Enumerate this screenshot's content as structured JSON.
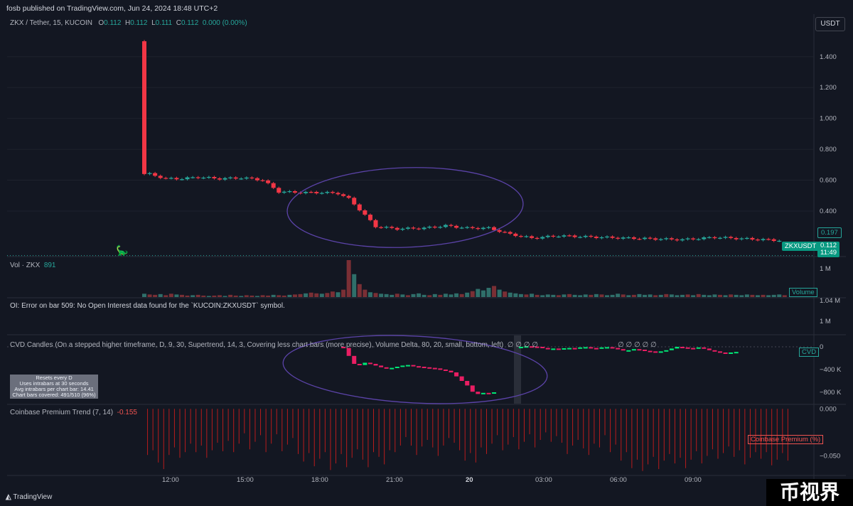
{
  "header": {
    "published": "fosb published on TradingView.com, Jun 24, 2024 18:48 UTC+2",
    "currency": "USDT"
  },
  "symbol_legend": {
    "name": "ZKX / Tether, 15, KUCOIN",
    "o_label": "O",
    "o": "0.112",
    "h_label": "H",
    "h": "0.112",
    "l_label": "L",
    "l": "0.111",
    "c_label": "C",
    "c": "0.112",
    "change": "0.000 (0.00%)"
  },
  "price_tags": {
    "last_line": "0.197",
    "symbol": "ZKXUSDT",
    "price": "0.112",
    "countdown": "11:49"
  },
  "volume_pane": {
    "title": "Vol · ZKX",
    "value": "891",
    "tag": "Volume"
  },
  "oi_pane": {
    "error": "OI: Error on bar 509: No Open Interest data found for the `KUCOIN:ZKXUSDT` symbol."
  },
  "cvd_pane": {
    "title": "CVD Candles (On a stepped higher timeframe, D, 9, 30, Supertrend, 14, 3, Covering less chart bars (more precise), Volume Delta, 80, 20, small, bottom, left)",
    "markers": "∅ ∅ ∅ ∅",
    "markers2": "∅ ∅ ∅ ∅ ∅",
    "tag": "CVD",
    "info_lines": [
      "Resets every D",
      "Uses intrabars at 30 seconds",
      "Avg intrabars per chart bar: 14.41",
      "Chart bars covered: 491/510 (96%)"
    ]
  },
  "premium_pane": {
    "title": "Coinbase Premium Trend (7, 14)",
    "value": "-0.155",
    "tag": "Coinbase Premium (%)"
  },
  "footer": {
    "logo": "TradingView",
    "watermark": "币视界"
  },
  "colors": {
    "bg": "#131722",
    "up": "#26a69a",
    "down": "#f23645",
    "cvd_up": "#00e676",
    "cvd_down": "#e91e63",
    "premium": "#b71c1c",
    "annotation": "#5b43a8"
  },
  "chart_data": [
    {
      "type": "candlestick",
      "title": "ZKX / Tether, 15, KUCOIN",
      "y_ticks": [
        "1.400",
        "1.200",
        "1.000",
        "0.800",
        "0.600",
        "0.400"
      ],
      "ylim": [
        0.11,
        1.56
      ],
      "x_ticks": [
        "12:00",
        "15:00",
        "18:00",
        "21:00",
        "20",
        "03:00",
        "06:00",
        "09:00"
      ],
      "close_path": [
        [
          0,
          1.5,
          0.64
        ],
        [
          1,
          0.64,
          0.61
        ],
        [
          4,
          0.61,
          0.61
        ],
        [
          7,
          0.61,
          0.62
        ],
        [
          10,
          0.62,
          0.61
        ],
        [
          14,
          0.61,
          0.615
        ],
        [
          18,
          0.615,
          0.61
        ],
        [
          20,
          0.61,
          0.6
        ],
        [
          22,
          0.6,
          0.525
        ],
        [
          25,
          0.525,
          0.52
        ],
        [
          30,
          0.52,
          0.52
        ],
        [
          33,
          0.52,
          0.515
        ],
        [
          36,
          0.515,
          0.48
        ],
        [
          38,
          0.48,
          0.41
        ],
        [
          40,
          0.41,
          0.3
        ],
        [
          43,
          0.3,
          0.285
        ],
        [
          47,
          0.285,
          0.29
        ],
        [
          52,
          0.29,
          0.305
        ],
        [
          56,
          0.305,
          0.29
        ],
        [
          60,
          0.29,
          0.29
        ],
        [
          64,
          0.29,
          0.25
        ],
        [
          68,
          0.25,
          0.225
        ],
        [
          72,
          0.225,
          0.24
        ],
        [
          77,
          0.24,
          0.23
        ],
        [
          85,
          0.23,
          0.22
        ],
        [
          95,
          0.22,
          0.215
        ],
        [
          100,
          0.215,
          0.23
        ],
        [
          106,
          0.23,
          0.22
        ],
        [
          112,
          0.22,
          0.21
        ],
        [
          118,
          0.21,
          0.197
        ]
      ],
      "last_price": 0.197,
      "current_price": 0.112,
      "annotation": "hand-drawn ellipse"
    },
    {
      "type": "bar",
      "title": "Vol · ZKX",
      "y_ticks": [
        "1 M",
        "1.04 M"
      ],
      "values": [
        0.09,
        0.07,
        0.06,
        0.08,
        0.05,
        0.09,
        0.07,
        0.06,
        0.04,
        0.05,
        0.06,
        0.04,
        0.03,
        0.04,
        0.05,
        0.03,
        0.06,
        0.04,
        0.03,
        0.05,
        0.04,
        0.03,
        0.05,
        0.04,
        0.06,
        0.05,
        0.04,
        0.06,
        0.07,
        0.08,
        0.1,
        0.12,
        0.1,
        0.09,
        0.11,
        0.15,
        0.13,
        0.2,
        1.0,
        0.62,
        0.35,
        0.2,
        0.13,
        0.11,
        0.09,
        0.08,
        0.06,
        0.09,
        0.07,
        0.05,
        0.08,
        0.1,
        0.06,
        0.05,
        0.08,
        0.06,
        0.09,
        0.07,
        0.1,
        0.08,
        0.12,
        0.16,
        0.22,
        0.18,
        0.25,
        0.3,
        0.2,
        0.15,
        0.12,
        0.1,
        0.08,
        0.07,
        0.09,
        0.06,
        0.05,
        0.07,
        0.06,
        0.05,
        0.07,
        0.08,
        0.06,
        0.05,
        0.07,
        0.06,
        0.08,
        0.07,
        0.05,
        0.06,
        0.09,
        0.07,
        0.05,
        0.06,
        0.08,
        0.06,
        0.07,
        0.05,
        0.06,
        0.08,
        0.07,
        0.05,
        0.06,
        0.07,
        0.05,
        0.08,
        0.06,
        0.05,
        0.07,
        0.06,
        0.05,
        0.07,
        0.06,
        0.05,
        0.07,
        0.06,
        0.05,
        0.06,
        0.05,
        0.06,
        0.07,
        0.05
      ]
    },
    {
      "type": "candlestick",
      "title": "CVD Candles",
      "y_ticks": [
        "0",
        "−400 K",
        "−800 K"
      ],
      "ylim": [
        -1000,
        200
      ],
      "x_ticks": [
        "03:00"
      ],
      "first_bar": 37,
      "closes": [
        -20,
        -160,
        -300,
        -320,
        -280,
        -300,
        -330,
        -360,
        -380,
        -370,
        -350,
        -330,
        -320,
        -340,
        -350,
        -360,
        -370,
        -380,
        -400,
        -420,
        -450,
        -520,
        -600,
        -680,
        -790,
        -830,
        -810,
        -820,
        -800
      ],
      "closes2": [
        0,
        10,
        5,
        0,
        -20,
        -30,
        -30,
        -35,
        -25,
        -20,
        -35,
        -10,
        -5,
        -20,
        -30,
        -10,
        -5,
        -20,
        -40,
        -60,
        -60,
        -40,
        -50,
        -70,
        -80,
        -90,
        -80,
        -60,
        -30,
        0,
        -10,
        -20,
        -30,
        -10,
        -30,
        -60,
        -80,
        -100,
        -120,
        -100,
        -90
      ]
    },
    {
      "type": "bar",
      "title": "Coinbase Premium Trend (7, 14)",
      "y_ticks": [
        "0.000",
        "−0.050"
      ],
      "ylim": [
        -0.07,
        0.004
      ],
      "x": [
        3,
        6,
        9,
        12,
        15,
        18,
        21,
        24,
        27,
        30,
        33,
        36,
        39,
        42,
        45,
        48,
        51,
        54,
        57,
        60,
        63,
        66,
        69,
        72,
        75,
        78,
        81,
        84,
        87,
        90,
        93,
        96,
        99,
        102,
        105,
        108,
        111,
        114,
        117,
        120,
        123,
        126,
        129,
        132,
        135,
        138,
        141,
        144,
        147,
        150,
        153,
        156,
        159,
        162,
        165,
        168,
        171,
        174,
        177,
        180,
        183,
        186,
        189,
        192,
        195,
        198,
        201,
        204,
        207,
        210,
        213,
        216,
        219,
        222,
        225,
        228,
        231,
        234,
        237,
        240,
        243,
        246,
        249,
        252,
        255,
        258,
        261,
        264,
        267,
        270,
        273,
        276,
        279,
        282,
        285,
        288,
        291,
        294,
        297,
        300,
        303,
        306,
        309,
        312,
        315,
        318,
        321,
        324,
        327,
        330,
        333,
        336,
        339,
        342,
        345,
        348,
        351,
        354,
        357,
        360
      ],
      "values": [
        -0.049,
        -0.044,
        -0.057,
        -0.064,
        -0.049,
        -0.041,
        -0.052,
        -0.046,
        -0.037,
        -0.046,
        -0.039,
        -0.052,
        -0.044,
        -0.036,
        -0.045,
        -0.034,
        -0.046,
        -0.037,
        -0.026,
        -0.043,
        -0.035,
        -0.028,
        -0.046,
        -0.037,
        -0.027,
        -0.045,
        -0.038,
        -0.031,
        -0.048,
        -0.056,
        -0.047,
        -0.061,
        -0.053,
        -0.046,
        -0.065,
        -0.058,
        -0.048,
        -0.062,
        -0.052,
        -0.043,
        -0.054,
        -0.062,
        -0.046,
        -0.051,
        -0.059,
        -0.044,
        -0.046,
        -0.039,
        -0.03,
        -0.039,
        -0.049,
        -0.04,
        -0.033,
        -0.041,
        -0.05,
        -0.039,
        -0.031,
        -0.036,
        -0.044,
        -0.055,
        -0.047,
        -0.057,
        -0.041,
        -0.048,
        -0.037,
        -0.028,
        -0.044,
        -0.038,
        -0.03,
        -0.043,
        -0.035,
        -0.027,
        -0.041,
        -0.033,
        -0.025,
        -0.035,
        -0.029,
        -0.036,
        -0.048,
        -0.039,
        -0.033,
        -0.042,
        -0.049,
        -0.037,
        -0.041,
        -0.028,
        -0.046,
        -0.038,
        -0.055,
        -0.046,
        -0.063,
        -0.054,
        -0.066,
        -0.059,
        -0.051,
        -0.064,
        -0.055,
        -0.048,
        -0.058,
        -0.052,
        -0.063,
        -0.054,
        -0.045,
        -0.058,
        -0.05,
        -0.043,
        -0.053,
        -0.047,
        -0.04,
        -0.051,
        -0.044,
        -0.059,
        -0.052,
        -0.046,
        -0.053,
        -0.046,
        -0.06,
        -0.054,
        -0.047,
        -0.055
      ]
    }
  ]
}
